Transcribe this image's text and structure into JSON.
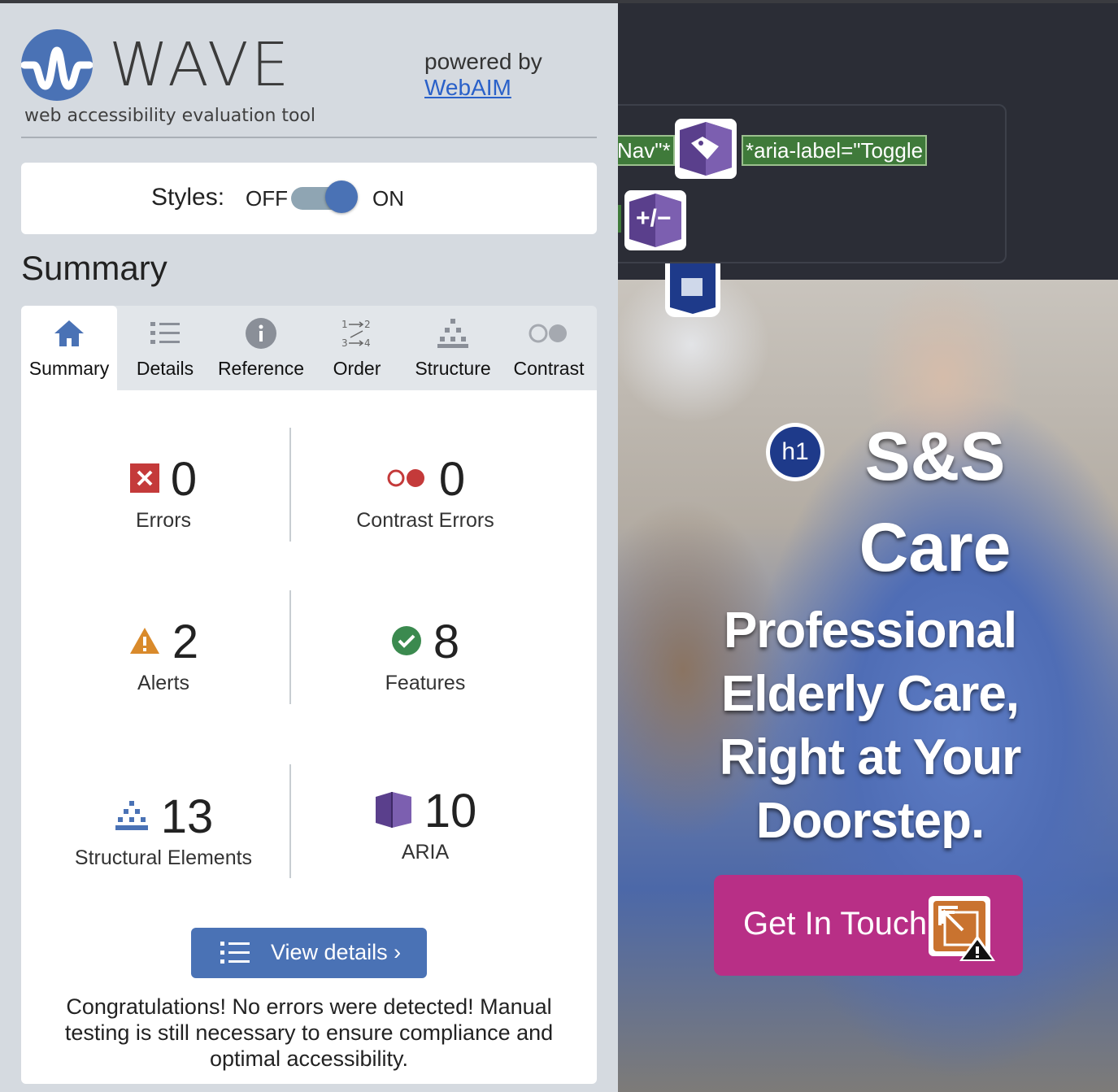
{
  "wave": {
    "title": "WAVE",
    "subtitle": "web accessibility evaluation tool",
    "powered_by": "powered by",
    "webaim_link": "WebAIM",
    "styles": {
      "label": "Styles:",
      "off": "OFF",
      "on": "ON",
      "state": "on"
    },
    "summary_heading": "Summary",
    "tabs": [
      {
        "label": "Summary",
        "icon": "home-icon",
        "active": true
      },
      {
        "label": "Details",
        "icon": "list-icon",
        "active": false
      },
      {
        "label": "Reference",
        "icon": "info-icon",
        "active": false
      },
      {
        "label": "Order",
        "icon": "order-icon",
        "active": false
      },
      {
        "label": "Structure",
        "icon": "structure-icon",
        "active": false
      },
      {
        "label": "Contrast",
        "icon": "contrast-icon",
        "active": false
      }
    ],
    "stats": {
      "errors": {
        "count": "0",
        "label": "Errors",
        "icon": "error-icon"
      },
      "contrast_errors": {
        "count": "0",
        "label": "Contrast Errors",
        "icon": "contrast-error-icon"
      },
      "alerts": {
        "count": "2",
        "label": "Alerts",
        "icon": "alert-icon"
      },
      "features": {
        "count": "8",
        "label": "Features",
        "icon": "feature-icon"
      },
      "structural": {
        "count": "13",
        "label": "Structural Elements",
        "icon": "structure-icon"
      },
      "aria": {
        "count": "10",
        "label": "ARIA",
        "icon": "aria-icon"
      }
    },
    "view_details": "View details ›",
    "congrats": "Congratulations! No errors were detected! Manual testing is still necessary to ensure compliance and optimal accessibility.",
    "colors": {
      "accent": "#4a72b5",
      "error": "#c43a3a",
      "alert": "#d98a2b",
      "feature": "#3b8a4f",
      "aria": "#5a3f8c"
    }
  },
  "site": {
    "nav_labels": {
      "label1": "Nav\"*",
      "label2": "*aria-label=\"Toggle"
    },
    "badges": {
      "tag": "aria-label-icon",
      "toggle": "+/−"
    },
    "h1_badge": "h1",
    "heading": "S&S Care",
    "subheading": "Professional Elderly Care, Right at Your Doorstep.",
    "cta": "Get In Touch",
    "colors": {
      "cta": "#b82f86"
    }
  }
}
